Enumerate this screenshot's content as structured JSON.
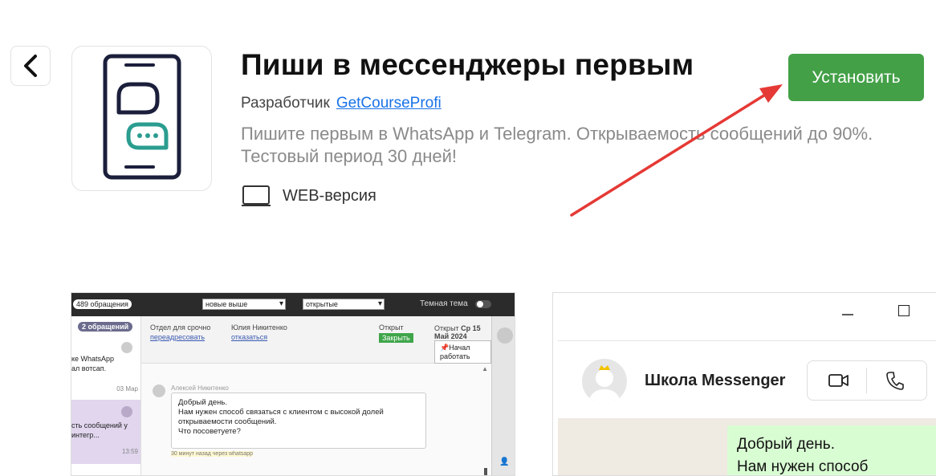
{
  "header": {
    "title": "Пиши в мессенджеры первым",
    "developer_label": "Разработчик",
    "developer_name": "GetCourseProfi",
    "description": "Пишите первым в WhatsApp и Telegram. Открываемость сообщений до 90%. Тестовый период 30 дней!",
    "platform": "WEB-версия",
    "install_label": "Установить"
  },
  "colors": {
    "accent": "#43a047",
    "icon_stroke": "#1b1f3b",
    "icon_accent": "#2a9d8f",
    "arrow": "#e53935"
  },
  "screenshot1": {
    "count": "489 обращения",
    "sort_select": "новые выше",
    "status_select": "открытые",
    "dark_theme": "Темная тема",
    "badge": "2 обращений",
    "conv1_text": [
      "ке WhatsApp",
      "ал вотсап."
    ],
    "conv1_date": "03 Мар",
    "conv2_text": [
      "сть сообщений у",
      " интегр..."
    ],
    "conv2_time": "13:59",
    "dept_label": "Отдел для срочно",
    "dept_link": "переадресовать",
    "user_label": "Юлия Никитенко",
    "user_link": "отказаться",
    "open_label": "Открыт",
    "close_btn": "Закрыть",
    "opened_label": "Открыт",
    "opened_date": "Ср 15 Май 2024",
    "start_btn": "Начал работать",
    "sender": "Алексей Никитенко",
    "message": [
      "Добрый день.",
      "Нам нужен способ связаться с клиентом с высокой долей",
      "открываемости сообщений.",
      "Что посоветуете?"
    ],
    "msg_time": "30 минут назад через whatsapp"
  },
  "screenshot2": {
    "chat_name": "Школа Messenger",
    "message": [
      "Добрый день.",
      "Нам нужен способ"
    ]
  }
}
